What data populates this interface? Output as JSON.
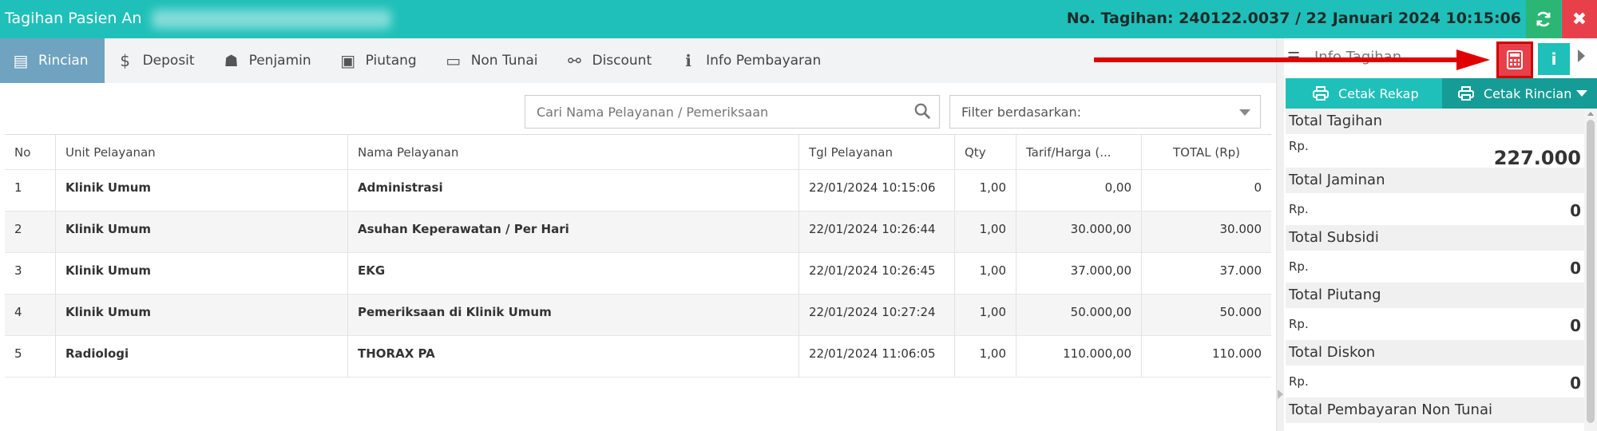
{
  "window": {
    "title": "Tagihan Pasien An",
    "bill_info": "No. Tagihan: 240122.0037 / 22 Januari 2024 10:15:06"
  },
  "tabs": [
    {
      "label": "Rincian",
      "icon": "list-icon"
    },
    {
      "label": "Deposit",
      "icon": "dollar-icon"
    },
    {
      "label": "Penjamin",
      "icon": "user-secret-icon"
    },
    {
      "label": "Piutang",
      "icon": "money-icon"
    },
    {
      "label": "Non Tunai",
      "icon": "credit-card-icon"
    },
    {
      "label": "Discount",
      "icon": "unlink-icon"
    },
    {
      "label": "Info Pembayaran",
      "icon": "info-icon"
    }
  ],
  "search": {
    "placeholder": "Cari Nama Pelayanan / Pemeriksaan"
  },
  "filter": {
    "label": "Filter berdasarkan:"
  },
  "table": {
    "headers": {
      "no": "No",
      "unit": "Unit Pelayanan",
      "name": "Nama Pelayanan",
      "tgl": "Tgl Pelayanan",
      "qty": "Qty",
      "tarif": "Tarif/Harga (...",
      "total": "TOTAL (Rp)"
    },
    "rows": [
      {
        "no": "1",
        "unit": "Klinik Umum",
        "name": "Administrasi",
        "tgl": "22/01/2024 10:15:06",
        "qty": "1,00",
        "tarif": "0,00",
        "total": "0"
      },
      {
        "no": "2",
        "unit": "Klinik Umum",
        "name": "Asuhan Keperawatan / Per Hari",
        "tgl": "22/01/2024 10:26:44",
        "qty": "1,00",
        "tarif": "30.000,00",
        "total": "30.000"
      },
      {
        "no": "3",
        "unit": "Klinik Umum",
        "name": "EKG",
        "tgl": "22/01/2024 10:26:45",
        "qty": "1,00",
        "tarif": "37.000,00",
        "total": "37.000"
      },
      {
        "no": "4",
        "unit": "Klinik Umum",
        "name": "Pemeriksaan di Klinik Umum",
        "tgl": "22/01/2024 10:27:24",
        "qty": "1,00",
        "tarif": "50.000,00",
        "total": "50.000"
      },
      {
        "no": "5",
        "unit": "Radiologi",
        "name": "THORAX PA",
        "tgl": "22/01/2024 11:06:05",
        "qty": "1,00",
        "tarif": "110.000,00",
        "total": "110.000"
      }
    ]
  },
  "panel": {
    "title": "Info Tagihan",
    "print_rekap": "Cetak Rekap",
    "print_rincian": "Cetak Rincian",
    "currency": "Rp.",
    "totals": [
      {
        "label": "Total Tagihan",
        "value": "227.000"
      },
      {
        "label": "Total Jaminan",
        "value": "0"
      },
      {
        "label": "Total Subsidi",
        "value": "0"
      },
      {
        "label": "Total Piutang",
        "value": "0"
      },
      {
        "label": "Total Diskon",
        "value": "0"
      },
      {
        "label": "Total Pembayaran Non Tunai",
        "value": ""
      }
    ]
  },
  "colors": {
    "accent": "#1fc0b9",
    "danger": "#e8404a",
    "active_tab": "#6fa3bf",
    "annotation": "#e00000"
  }
}
